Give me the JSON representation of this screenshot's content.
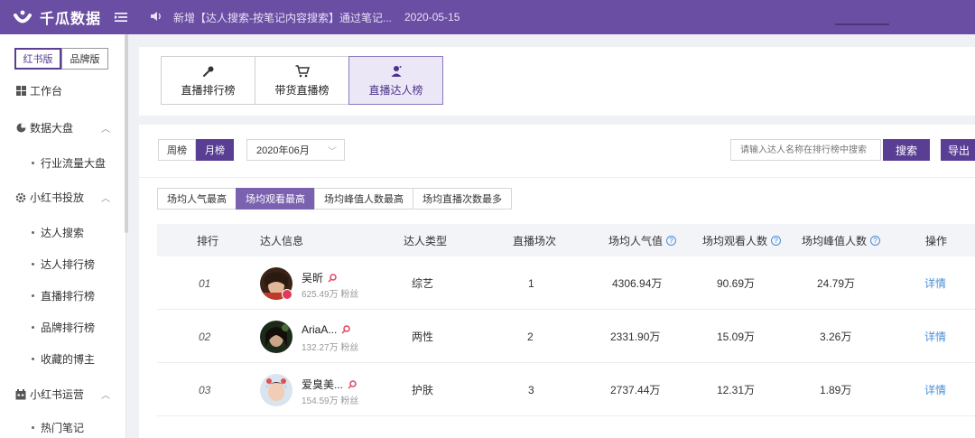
{
  "header": {
    "brand": "千瓜数据",
    "notice_text": "新增【达人搜索-按笔记内容搜索】通过笔记...",
    "notice_date": "2020-05-15",
    "colors": {
      "primary": "#6a4ea3",
      "accent": "#5a3e94",
      "link": "#4a8fd8"
    }
  },
  "sidebar": {
    "version_tabs": [
      "红书版",
      "品牌版"
    ],
    "active_version": "红书版",
    "workbench": "工作台",
    "sections": [
      {
        "label": "数据大盘",
        "icon": "pie-chart-icon",
        "items": [
          "行业流量大盘"
        ]
      },
      {
        "label": "小红书投放",
        "icon": "gear-icon",
        "items": [
          "达人搜索",
          "达人排行榜",
          "直播排行榜",
          "品牌排行榜",
          "收藏的博主"
        ]
      },
      {
        "label": "小红书运营",
        "icon": "calendar-icon",
        "items": [
          "热门笔记"
        ]
      }
    ]
  },
  "main_tabs": [
    {
      "label": "直播排行榜",
      "icon": "microphone-icon",
      "active": false
    },
    {
      "label": "带货直播榜",
      "icon": "cart-icon",
      "active": false
    },
    {
      "label": "直播达人榜",
      "icon": "person-icon",
      "active": true
    }
  ],
  "filters": {
    "period_options": [
      "周榜",
      "月榜"
    ],
    "active_period": "月榜",
    "month": "2020年06月",
    "search_placeholder": "请输入达人名称在排行榜中搜索",
    "search_label": "搜索",
    "export_label": "导出"
  },
  "metric_tabs": [
    "场均人气最高",
    "场均观看最高",
    "场均峰值人数最高",
    "场均直播次数最多"
  ],
  "active_metric": "场均观看最高",
  "table": {
    "columns": [
      "排行",
      "达人信息",
      "达人类型",
      "直播场次",
      "场均人气值",
      "场均观看人数",
      "场均峰值人数",
      "操作"
    ],
    "fans_suffix": "粉丝",
    "rows": [
      {
        "rank": "01",
        "name": "吴昕",
        "fans": "625.49万",
        "type": "综艺",
        "sessions": "1",
        "avg_popularity": "4306.94万",
        "avg_viewers": "90.69万",
        "avg_peak": "24.79万",
        "action": "详情"
      },
      {
        "rank": "02",
        "name": "AriaA...",
        "fans": "132.27万",
        "type": "两性",
        "sessions": "2",
        "avg_popularity": "2331.90万",
        "avg_viewers": "15.09万",
        "avg_peak": "3.26万",
        "action": "详情"
      },
      {
        "rank": "03",
        "name": "爱臭美...",
        "fans": "154.59万",
        "type": "护肤",
        "sessions": "3",
        "avg_popularity": "2737.44万",
        "avg_viewers": "12.31万",
        "avg_peak": "1.89万",
        "action": "详情"
      }
    ]
  }
}
